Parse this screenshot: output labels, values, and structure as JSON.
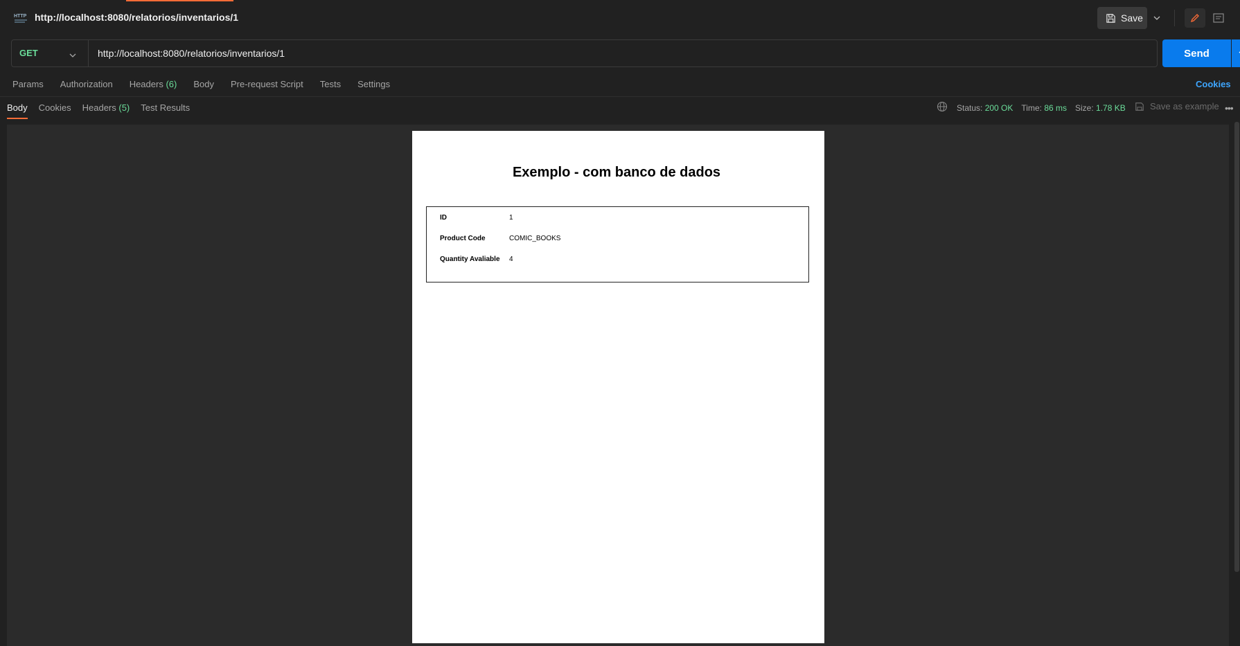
{
  "header": {
    "request_title": "http://localhost:8080/relatorios/inventarios/1",
    "save_label": "Save",
    "http_icon_text": "HTTP"
  },
  "request": {
    "method": "GET",
    "url": "http://localhost:8080/relatorios/inventarios/1",
    "send_label": "Send",
    "tabs": [
      {
        "label": "Params"
      },
      {
        "label": "Authorization"
      },
      {
        "label": "Headers",
        "count": "(6)"
      },
      {
        "label": "Body"
      },
      {
        "label": "Pre-request Script"
      },
      {
        "label": "Tests"
      },
      {
        "label": "Settings"
      }
    ],
    "cookies_link": "Cookies"
  },
  "response": {
    "tabs": [
      {
        "label": "Body"
      },
      {
        "label": "Cookies"
      },
      {
        "label": "Headers",
        "count": "(5)"
      },
      {
        "label": "Test Results"
      }
    ],
    "status_label": "Status:",
    "status_value": "200 OK",
    "time_label": "Time:",
    "time_value": "86 ms",
    "size_label": "Size:",
    "size_value": "1.78 KB",
    "save_example_label": "Save as example"
  },
  "pdf": {
    "title": "Exemplo - com banco de dados",
    "rows": [
      {
        "label": "ID",
        "value": "1"
      },
      {
        "label": "Product Code",
        "value": "COMIC_BOOKS"
      },
      {
        "label": "Quantity Avaliable",
        "value": "4"
      }
    ]
  },
  "colors": {
    "accent": "#ff6c37",
    "send_button": "#097bed",
    "success": "#6bdd9a",
    "link": "#3ea6ff"
  }
}
